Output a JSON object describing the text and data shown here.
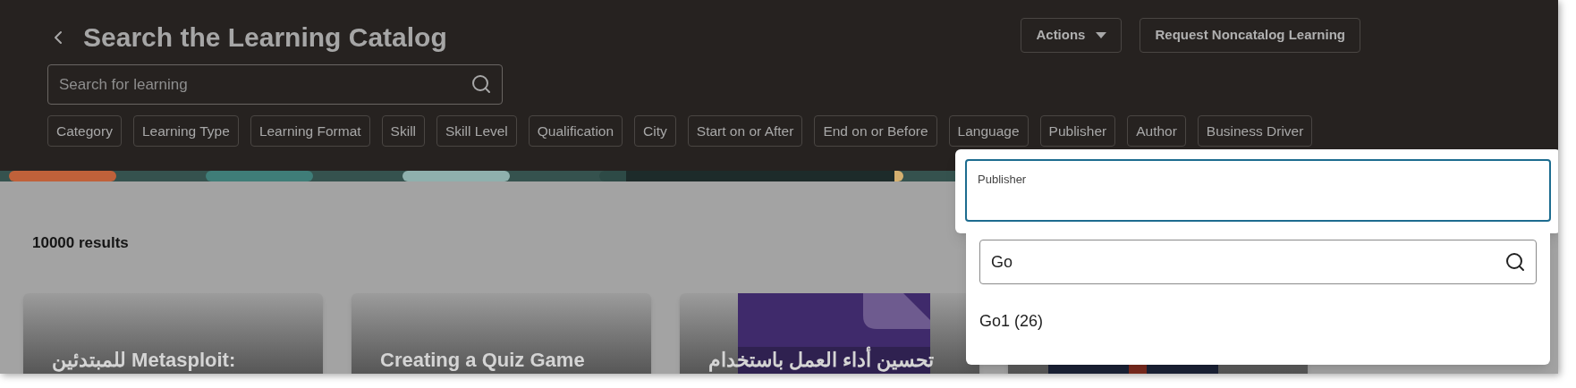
{
  "header": {
    "title": "Search the Learning Catalog",
    "search": {
      "placeholder": "Search for learning"
    },
    "actions": [
      {
        "label": "Actions",
        "kind": "menu"
      },
      {
        "label": "Request Noncatalog Learning",
        "kind": "button"
      }
    ],
    "filters": [
      "Category",
      "Learning Type",
      "Learning Format",
      "Skill",
      "Skill Level",
      "Qualification",
      "City",
      "Start on or After",
      "End on or Before",
      "Language",
      "Publisher",
      "Author",
      "Business Driver"
    ]
  },
  "results": {
    "count": "10000 results",
    "cards": [
      {
        "title": "للمبتدئين Metasploit:",
        "kind": "plain"
      },
      {
        "title": "Creating a Quiz Game",
        "kind": "plain"
      },
      {
        "title": "تحسين أداء العمل باستخدام",
        "kind": "picture"
      },
      {
        "kind": "picture"
      }
    ]
  },
  "publisher_popup": {
    "label": "Publisher",
    "search": {
      "value": "Go"
    },
    "options": [
      "Go1 (26)"
    ]
  }
}
